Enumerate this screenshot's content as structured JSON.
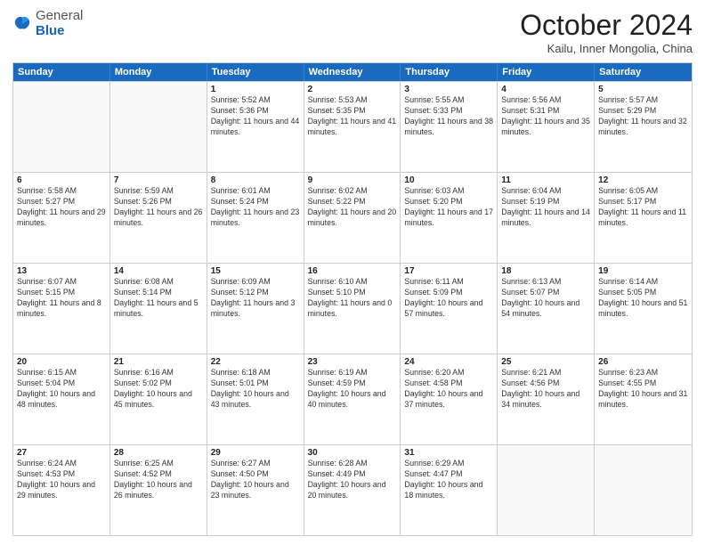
{
  "logo": {
    "general": "General",
    "blue": "Blue"
  },
  "title": "October 2024",
  "subtitle": "Kailu, Inner Mongolia, China",
  "header_days": [
    "Sunday",
    "Monday",
    "Tuesday",
    "Wednesday",
    "Thursday",
    "Friday",
    "Saturday"
  ],
  "weeks": [
    [
      {
        "day": "",
        "empty": true
      },
      {
        "day": "",
        "empty": true
      },
      {
        "day": "1",
        "text": "Sunrise: 5:52 AM\nSunset: 5:36 PM\nDaylight: 11 hours and 44 minutes."
      },
      {
        "day": "2",
        "text": "Sunrise: 5:53 AM\nSunset: 5:35 PM\nDaylight: 11 hours and 41 minutes."
      },
      {
        "day": "3",
        "text": "Sunrise: 5:55 AM\nSunset: 5:33 PM\nDaylight: 11 hours and 38 minutes."
      },
      {
        "day": "4",
        "text": "Sunrise: 5:56 AM\nSunset: 5:31 PM\nDaylight: 11 hours and 35 minutes."
      },
      {
        "day": "5",
        "text": "Sunrise: 5:57 AM\nSunset: 5:29 PM\nDaylight: 11 hours and 32 minutes."
      }
    ],
    [
      {
        "day": "6",
        "text": "Sunrise: 5:58 AM\nSunset: 5:27 PM\nDaylight: 11 hours and 29 minutes."
      },
      {
        "day": "7",
        "text": "Sunrise: 5:59 AM\nSunset: 5:26 PM\nDaylight: 11 hours and 26 minutes."
      },
      {
        "day": "8",
        "text": "Sunrise: 6:01 AM\nSunset: 5:24 PM\nDaylight: 11 hours and 23 minutes."
      },
      {
        "day": "9",
        "text": "Sunrise: 6:02 AM\nSunset: 5:22 PM\nDaylight: 11 hours and 20 minutes."
      },
      {
        "day": "10",
        "text": "Sunrise: 6:03 AM\nSunset: 5:20 PM\nDaylight: 11 hours and 17 minutes."
      },
      {
        "day": "11",
        "text": "Sunrise: 6:04 AM\nSunset: 5:19 PM\nDaylight: 11 hours and 14 minutes."
      },
      {
        "day": "12",
        "text": "Sunrise: 6:05 AM\nSunset: 5:17 PM\nDaylight: 11 hours and 11 minutes."
      }
    ],
    [
      {
        "day": "13",
        "text": "Sunrise: 6:07 AM\nSunset: 5:15 PM\nDaylight: 11 hours and 8 minutes."
      },
      {
        "day": "14",
        "text": "Sunrise: 6:08 AM\nSunset: 5:14 PM\nDaylight: 11 hours and 5 minutes."
      },
      {
        "day": "15",
        "text": "Sunrise: 6:09 AM\nSunset: 5:12 PM\nDaylight: 11 hours and 3 minutes."
      },
      {
        "day": "16",
        "text": "Sunrise: 6:10 AM\nSunset: 5:10 PM\nDaylight: 11 hours and 0 minutes."
      },
      {
        "day": "17",
        "text": "Sunrise: 6:11 AM\nSunset: 5:09 PM\nDaylight: 10 hours and 57 minutes."
      },
      {
        "day": "18",
        "text": "Sunrise: 6:13 AM\nSunset: 5:07 PM\nDaylight: 10 hours and 54 minutes."
      },
      {
        "day": "19",
        "text": "Sunrise: 6:14 AM\nSunset: 5:05 PM\nDaylight: 10 hours and 51 minutes."
      }
    ],
    [
      {
        "day": "20",
        "text": "Sunrise: 6:15 AM\nSunset: 5:04 PM\nDaylight: 10 hours and 48 minutes."
      },
      {
        "day": "21",
        "text": "Sunrise: 6:16 AM\nSunset: 5:02 PM\nDaylight: 10 hours and 45 minutes."
      },
      {
        "day": "22",
        "text": "Sunrise: 6:18 AM\nSunset: 5:01 PM\nDaylight: 10 hours and 43 minutes."
      },
      {
        "day": "23",
        "text": "Sunrise: 6:19 AM\nSunset: 4:59 PM\nDaylight: 10 hours and 40 minutes."
      },
      {
        "day": "24",
        "text": "Sunrise: 6:20 AM\nSunset: 4:58 PM\nDaylight: 10 hours and 37 minutes."
      },
      {
        "day": "25",
        "text": "Sunrise: 6:21 AM\nSunset: 4:56 PM\nDaylight: 10 hours and 34 minutes."
      },
      {
        "day": "26",
        "text": "Sunrise: 6:23 AM\nSunset: 4:55 PM\nDaylight: 10 hours and 31 minutes."
      }
    ],
    [
      {
        "day": "27",
        "text": "Sunrise: 6:24 AM\nSunset: 4:53 PM\nDaylight: 10 hours and 29 minutes."
      },
      {
        "day": "28",
        "text": "Sunrise: 6:25 AM\nSunset: 4:52 PM\nDaylight: 10 hours and 26 minutes."
      },
      {
        "day": "29",
        "text": "Sunrise: 6:27 AM\nSunset: 4:50 PM\nDaylight: 10 hours and 23 minutes."
      },
      {
        "day": "30",
        "text": "Sunrise: 6:28 AM\nSunset: 4:49 PM\nDaylight: 10 hours and 20 minutes."
      },
      {
        "day": "31",
        "text": "Sunrise: 6:29 AM\nSunset: 4:47 PM\nDaylight: 10 hours and 18 minutes."
      },
      {
        "day": "",
        "empty": true
      },
      {
        "day": "",
        "empty": true
      }
    ]
  ]
}
